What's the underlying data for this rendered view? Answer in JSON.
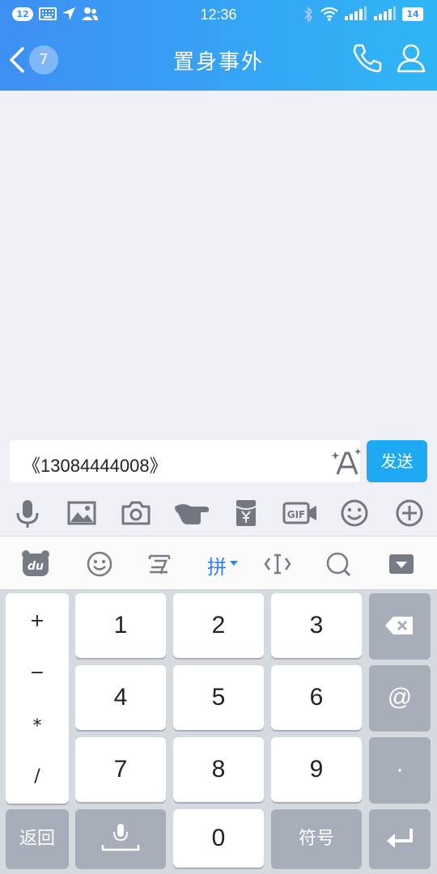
{
  "status_bar": {
    "notification_count": "12",
    "time": "12:36",
    "battery": "14"
  },
  "nav": {
    "unread_count": "7",
    "title": "置身事外"
  },
  "composer": {
    "input_value": "《13084444008》",
    "send_label": "发送"
  },
  "toolbar": {
    "icons": [
      "microphone-icon",
      "image-icon",
      "camera-icon",
      "poke-icon",
      "red-packet-icon",
      "gif-icon",
      "emoji-icon",
      "plus-icon"
    ]
  },
  "ime": {
    "pinyin_label": "拼",
    "icons": [
      "du-logo-icon",
      "emoji-icon",
      "handwrite-icon",
      "pinyin-mode",
      "cursor-move-icon",
      "search-icon",
      "hide-keyboard-icon"
    ]
  },
  "keyboard": {
    "symbols": [
      "+",
      "−",
      "*",
      "/"
    ],
    "digits": [
      "1",
      "2",
      "3",
      "4",
      "5",
      "6",
      "7",
      "8",
      "9"
    ],
    "at_key": "@",
    "dot_key": "·",
    "back_label": "返回",
    "zero_key": "0",
    "symbols_label": "符号"
  },
  "colors": {
    "header_start": "#3e8ff3",
    "header_end": "#2fb6f6",
    "send_button": "#1fa9f3",
    "ime_accent": "#2f82e8"
  }
}
